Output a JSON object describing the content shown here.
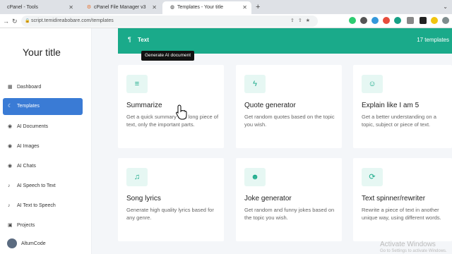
{
  "browser": {
    "tabs": [
      {
        "label": "cPanel - Tools",
        "icon": "cpanel-icon"
      },
      {
        "label": "cPanel File Manager v3",
        "icon": "cpanel-icon"
      },
      {
        "label": "Templates - Your title",
        "icon": "globe-icon"
      }
    ],
    "url": "script.temidireabobare.com/templates"
  },
  "sidebar": {
    "site_title": "Your title",
    "items": [
      {
        "label": "Dashboard",
        "icon": "grid-icon"
      },
      {
        "label": "Templates",
        "icon": "moon-icon",
        "active": true
      },
      {
        "label": "AI Documents",
        "icon": "robot-icon"
      },
      {
        "label": "AI Images",
        "icon": "robot-icon"
      },
      {
        "label": "AI Chats",
        "icon": "robot-icon"
      },
      {
        "label": "AI Speech to Text",
        "icon": "microphone-icon"
      },
      {
        "label": "AI Text to Speech",
        "icon": "microphone-icon"
      },
      {
        "label": "Projects",
        "icon": "folder-icon"
      }
    ],
    "brand": "AltumCode"
  },
  "header": {
    "title": "Text",
    "count": "17 templates",
    "accent": "#1aaa8a"
  },
  "tooltip": "Generate AI document",
  "cards": [
    {
      "title": "Summarize",
      "desc": "Get a quick summary of a long piece of text, only the important parts.",
      "icon": "align-left-icon"
    },
    {
      "title": "Quote generator",
      "desc": "Get random quotes based on the topic you wish.",
      "icon": "bolt-icon"
    },
    {
      "title": "Explain like I am 5",
      "desc": "Get a better understanding on a topic, subject or piece of text.",
      "icon": "child-icon"
    },
    {
      "title": "Song lyrics",
      "desc": "Generate high quality lyrics based for any genre.",
      "icon": "music-icon"
    },
    {
      "title": "Joke generator",
      "desc": "Get random and funny jokes based on the topic you wish.",
      "icon": "smile-icon"
    },
    {
      "title": "Text spinner/rewriter",
      "desc": "Rewrite a piece of text in another unique way, using different words.",
      "icon": "sync-icon"
    }
  ],
  "watermark": {
    "title": "Activate Windows",
    "sub": "Go to Settings to activate Windows."
  }
}
